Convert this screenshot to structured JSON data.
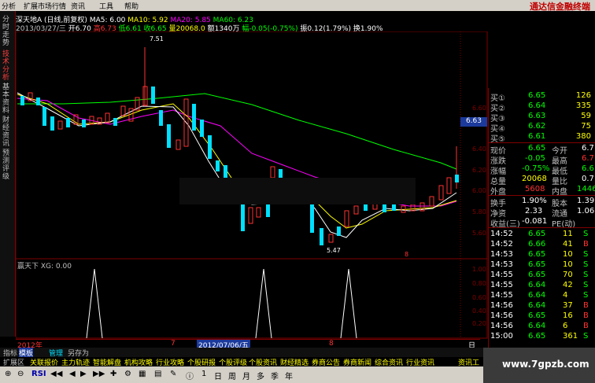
{
  "menu": {
    "items": [
      "分析",
      "扩展市场行情",
      "资讯",
      "工具",
      "帮助"
    ]
  },
  "banner": {
    "text": "通达信金融终端"
  },
  "left_tabs": [
    {
      "label": "分时走势"
    },
    {
      "label": "技术分析"
    },
    {
      "label": "基本资料"
    },
    {
      "label": "财经资讯"
    },
    {
      "label": "预测评级"
    }
  ],
  "info": {
    "line1": {
      "title": "深天地A",
      "mode": "(日线,前复权)",
      "ma5": "MA5: 6.00",
      "ma10": "MA10: 5.92",
      "ma20": "MA20: 5.85",
      "ma60": "MA60: 6.23"
    },
    "line2": {
      "date": "2013/03/27/三",
      "open": "开6.70",
      "high": "高6.73",
      "low": "低6.61",
      "close": "收6.65",
      "volume": "量20068.0",
      "amount": "额1340万",
      "change": "幅-0.05(-0.75%)",
      "amplitude": "振0.12(1.79%)",
      "turnover": "换1.90%"
    }
  },
  "price_axis": {
    "ticks": [
      "6.60",
      "6.40",
      "6.20",
      "6.00",
      "5.80",
      "5.60"
    ],
    "current_badge": "6.63"
  },
  "annotations": {
    "high": "7.51",
    "low": "5.47",
    "marker": "8"
  },
  "indicator": {
    "label": "赢天下 XG: 0.00",
    "ticks": [
      "1.00",
      "0.80",
      "0.60",
      "0.40",
      "0.20"
    ]
  },
  "date_axis": {
    "year": "2012年",
    "month7": "7",
    "selected": "2012/07/06/五",
    "month8": "8",
    "unit": "日线"
  },
  "bottom_tabs": [
    "指标",
    "模板",
    "管理",
    "另存为"
  ],
  "func_tabs": [
    "扩展区",
    "关联报价",
    "主力轨迹",
    "智能解盘",
    "机构攻略",
    "行业攻略",
    "个股研报",
    "个股评级",
    "个股资讯",
    "财经精选",
    "券商公告",
    "券商新闻",
    "综合资讯",
    "行业资讯",
    "资讯工"
  ],
  "toolbar": {
    "rsi": "RSI",
    "periods": [
      "日",
      "周",
      "月",
      "多",
      "季",
      "年"
    ]
  },
  "watermark": "www.7gpzb.com",
  "order_book": [
    {
      "label": "买①",
      "price": "6.65",
      "volume": "126"
    },
    {
      "label": "买②",
      "price": "6.64",
      "volume": "335"
    },
    {
      "label": "买③",
      "price": "6.63",
      "volume": "59"
    },
    {
      "label": "买④",
      "price": "6.62",
      "volume": "75"
    },
    {
      "label": "买⑤",
      "price": "6.61",
      "volume": "380"
    }
  ],
  "quote": {
    "xianjia_l": "现价",
    "xianjia_v": "6.65",
    "jinkai_l": "今开",
    "jinkai_v": "6.7",
    "zhangdie_l": "涨跌",
    "zhangdie_v": "-0.05",
    "zuigao_l": "最高",
    "zuigao_v": "6.7",
    "zhangfu_l": "涨幅",
    "zhangfu_v": "-0.75%",
    "zuidi_l": "最低",
    "zuidi_v": "6.6",
    "zongliang_l": "总量",
    "zongliang_v": "20068",
    "liangbi_l": "量比",
    "liangbi_v": "0.7",
    "waipan_l": "外盘",
    "waipan_v": "5608",
    "neipan_l": "内盘",
    "neipan_v": "1446",
    "huanshou_l": "换手",
    "huanshou_v": "1.90%",
    "guben_l": "股本",
    "guben_v": "1.39",
    "jingzi_l": "净资",
    "jingzi_v": "2.33",
    "liutong_l": "流通",
    "liutong_v": "1.06",
    "shouyi_l": "收益(三)",
    "shouyi_v": "-0.081",
    "pe_l": "PE(动)",
    "pe_v": ""
  },
  "ticks": [
    {
      "time": "14:52",
      "price": "6.65",
      "vol": "11",
      "side": "S"
    },
    {
      "time": "14:52",
      "price": "6.66",
      "vol": "41",
      "side": "B"
    },
    {
      "time": "14:53",
      "price": "6.65",
      "vol": "10",
      "side": "S"
    },
    {
      "time": "14:53",
      "price": "6.65",
      "vol": "10",
      "side": "S"
    },
    {
      "time": "14:55",
      "price": "6.65",
      "vol": "70",
      "side": "S"
    },
    {
      "time": "14:55",
      "price": "6.64",
      "vol": "42",
      "side": "S"
    },
    {
      "time": "14:55",
      "price": "6.64",
      "vol": "4",
      "side": "S"
    },
    {
      "time": "14:56",
      "price": "6.64",
      "vol": "37",
      "side": "B"
    },
    {
      "time": "14:56",
      "price": "6.65",
      "vol": "16",
      "side": "B"
    },
    {
      "time": "14:56",
      "price": "6.64",
      "vol": "6",
      "side": "B"
    },
    {
      "time": "15:00",
      "price": "6.65",
      "vol": "361",
      "side": "S"
    }
  ],
  "colors": {
    "up": "#ff3232",
    "down": "#00e0ff",
    "ma5": "#ffffff",
    "ma10": "#ffff00",
    "ma20": "#ff00ff",
    "ma60": "#00ff00",
    "frame": "#800000"
  }
}
